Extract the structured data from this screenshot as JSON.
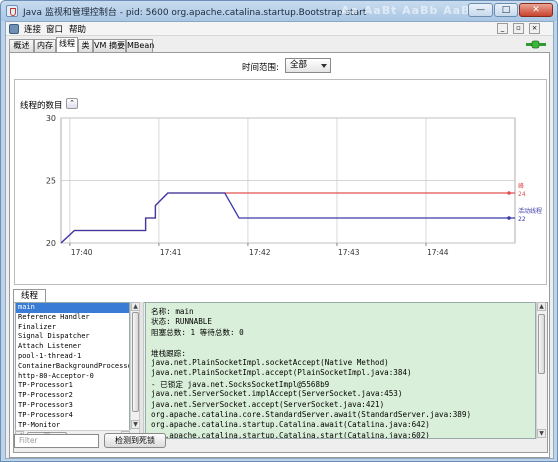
{
  "window": {
    "title": "Java 监视和管理控制台 - pid: 5600 org.apache.catalina.startup.Bootstrap start",
    "background_watermark": "Aa  AaBt  AaBb  AaBb  AaBb",
    "minimize": "—",
    "maximize": "□",
    "close": "✕"
  },
  "menubar": {
    "items": [
      "连接",
      "窗口",
      "帮助"
    ],
    "mdi": [
      "_",
      "▫",
      "×"
    ]
  },
  "tabs": [
    "概述",
    "内存",
    "线程",
    "类",
    "VM 摘要",
    "MBean"
  ],
  "active_tab": "线程",
  "range": {
    "label": "时间范围:",
    "value": "全部"
  },
  "chart": {
    "panel_title": "线程的数目",
    "collapse_glyph": "⌃"
  },
  "chart_data": {
    "type": "line",
    "x": [
      "17:40",
      "17:41",
      "17:42",
      "17:43",
      "17:44"
    ],
    "ylim": [
      20,
      30
    ],
    "yticks": [
      20,
      25,
      30
    ],
    "series": [
      {
        "name": "峰",
        "color": "#e05050",
        "current": 24,
        "points": [
          [
            0,
            20
          ],
          [
            0.15,
            21
          ],
          [
            0.95,
            21
          ],
          [
            0.95,
            22
          ],
          [
            1.06,
            22
          ],
          [
            1.06,
            23
          ],
          [
            1.2,
            24
          ],
          [
            1.84,
            24
          ],
          [
            5.1,
            24
          ]
        ]
      },
      {
        "name": "活动线程",
        "color": "#3a3aa8",
        "current": 22,
        "points": [
          [
            0,
            20
          ],
          [
            0.15,
            21
          ],
          [
            0.95,
            21
          ],
          [
            0.95,
            22
          ],
          [
            1.06,
            22
          ],
          [
            1.06,
            23
          ],
          [
            1.2,
            24
          ],
          [
            1.84,
            24
          ],
          [
            2.0,
            22
          ],
          [
            5.1,
            22
          ]
        ]
      }
    ]
  },
  "threads": {
    "tab_label": "线程",
    "list": [
      "main",
      "Reference Handler",
      "Finalizer",
      "Signal Dispatcher",
      "Attach Listener",
      "pool-1-thread-1",
      "ContainerBackgroundProcessor[S",
      "http-80-Acceptor-0",
      "TP-Processor1",
      "TP-Processor2",
      "TP-Processor3",
      "TP-Processor4",
      "TP-Monitor",
      "RMI TCP Accept-0"
    ],
    "selected": "main",
    "details": [
      "名称: main",
      "状态: RUNNABLE",
      "阻塞总数: 1  等待总数: 0",
      "",
      "堆栈跟踪:",
      "java.net.PlainSocketImpl.socketAccept(Native Method)",
      "java.net.PlainSocketImpl.accept(PlainSocketImpl.java:384)",
      "   - 已锁定 java.net.SocksSocketImpl@5568b9",
      "java.net.ServerSocket.implAccept(ServerSocket.java:453)",
      "java.net.ServerSocket.accept(ServerSocket.java:421)",
      "org.apache.catalina.core.StandardServer.await(StandardServer.java:389)",
      "org.apache.catalina.startup.Catalina.await(Catalina.java:642)",
      "org.apache.catalina.startup.Catalina.start(Catalina.java:602)"
    ],
    "filter_placeholder": "Filter",
    "deadlock_button": "检测到死锁"
  },
  "scroll_arrows": {
    "up": "▲",
    "down": "▼",
    "left": "◀",
    "right": "▶",
    "grip": "|||"
  }
}
